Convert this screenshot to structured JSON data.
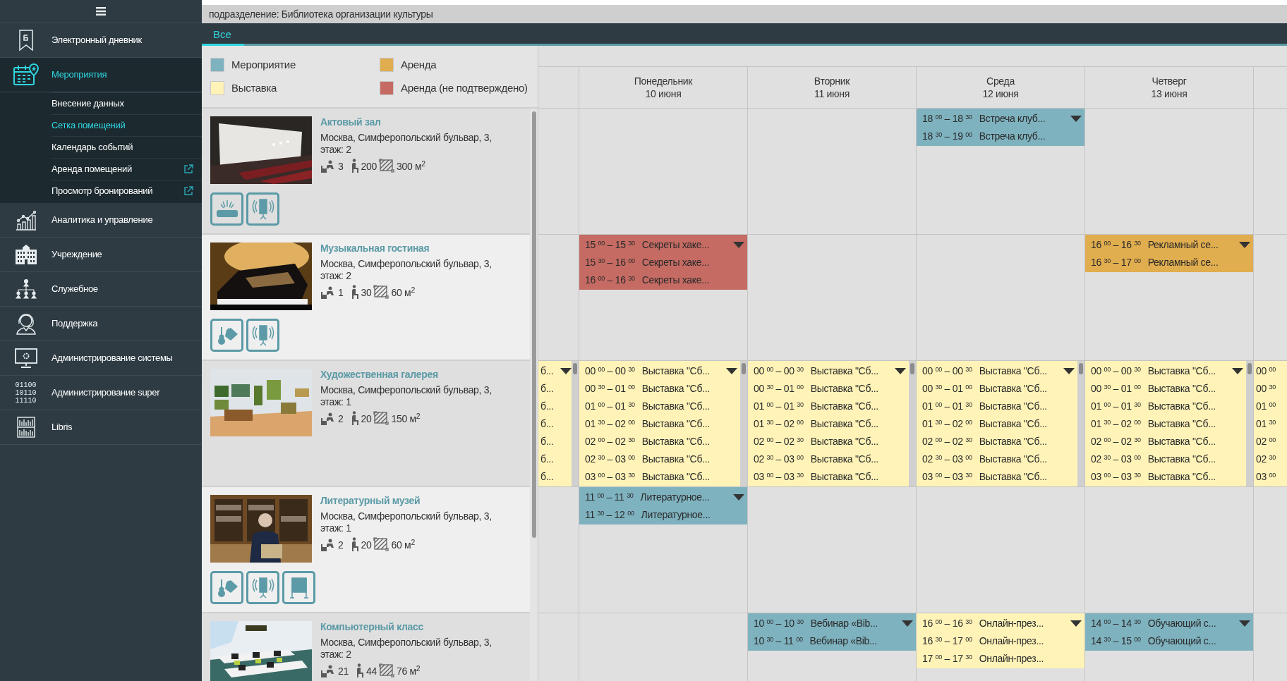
{
  "sidebar": {
    "items": [
      {
        "label": "Электронный дневник",
        "selected": false,
        "expanded": false
      },
      {
        "label": "Мероприятия",
        "selected": true,
        "expanded": true,
        "children": [
          {
            "label": "Внесение данных",
            "selected": false,
            "external": false
          },
          {
            "label": "Сетка помещений",
            "selected": true,
            "external": false
          },
          {
            "label": "Календарь событий",
            "selected": false,
            "external": false
          },
          {
            "label": "Аренда помещений",
            "selected": false,
            "external": true
          },
          {
            "label": "Просмотр бронирований",
            "selected": false,
            "external": true
          }
        ]
      },
      {
        "label": "Аналитика и управление",
        "selected": false,
        "expanded": false
      },
      {
        "label": "Учреждение",
        "selected": false,
        "expanded": false
      },
      {
        "label": "Служебное",
        "selected": false,
        "expanded": false
      },
      {
        "label": "Поддержка",
        "selected": false,
        "expanded": false
      },
      {
        "label": "Администрирование системы",
        "selected": false,
        "expanded": false
      },
      {
        "label": "Администрирование super",
        "selected": false,
        "expanded": false,
        "icon_text": [
          "01100",
          "10110",
          "11110"
        ]
      },
      {
        "label": "Libris",
        "selected": false,
        "expanded": false
      }
    ]
  },
  "header": {
    "subdivision": "подразделение: Библиотека организации культуры"
  },
  "tabs": [
    {
      "label": "Все",
      "selected": true
    }
  ],
  "legend": [
    {
      "label": "Мероприятие",
      "color": "#7fb2bf"
    },
    {
      "label": "Аренда",
      "color": "#e0ad4f"
    },
    {
      "label": "Выставка",
      "color": "#fff3b8"
    },
    {
      "label": "Аренда (не подтверждено)",
      "color": "#c56b63"
    }
  ],
  "rooms": [
    {
      "name": "Актовый зал",
      "address": "Москва, Симферопольский бульвар, 3,",
      "floor": "этаж: 2",
      "workplaces": "3",
      "seats": "200",
      "area": "300 м$^{2}$",
      "equipment": [
        {
          "kind": "projector"
        },
        {
          "kind": "speaker"
        }
      ]
    },
    {
      "name": "Музыкальная гостиная",
      "address": "Москва, Симферопольский бульвар, 3,",
      "floor": "этаж: 2",
      "workplaces": "1",
      "seats": "30",
      "area": "60 м$^{2}$",
      "equipment": [
        {
          "kind": "instruments"
        },
        {
          "kind": "speaker"
        }
      ]
    },
    {
      "name": "Художественная галерея",
      "address": "Москва, Симферопольский бульвар, 3,",
      "floor": "этаж: 1",
      "workplaces": "2",
      "seats": "20",
      "area": "150 м$^{2}$"
    },
    {
      "name": "Литературный музей",
      "address": "Москва, Симферопольский бульвар, 3,",
      "floor": "этаж: 1",
      "workplaces": "2",
      "seats": "20",
      "area": "60 м$^{2}$",
      "equipment": [
        {
          "kind": "instruments"
        },
        {
          "kind": "speaker"
        },
        {
          "kind": "flipchart"
        }
      ]
    },
    {
      "name": "Компьютерный класс",
      "address": "Москва, Симферопольский бульвар, 3,",
      "floor": "этаж: 2",
      "workplaces": "21",
      "seats": "44",
      "area": "76 м$^{2}$"
    }
  ],
  "calendar": {
    "days": [
      {
        "weekday": "Понедельник",
        "date": "10 июня"
      },
      {
        "weekday": "Вторник",
        "date": "11 июня"
      },
      {
        "weekday": "Среда",
        "date": "12 июня"
      },
      {
        "weekday": "Четверг",
        "date": "13 июня"
      }
    ],
    "rows": [
      {
        "cells": [
          {},
          {},
          {},
          {
            "color": "#7fb2bf",
            "dropdown": true,
            "scrollbar": false,
            "lines": [
              {
                "time": "18 $^{00}$ – 18 $^{30}$",
                "title": "Встреча клуб..."
              },
              {
                "time": "18 $^{30}$ – 19 $^{00}$",
                "title": "Встреча клуб..."
              }
            ]
          },
          {},
          {}
        ]
      },
      {
        "cells": [
          {},
          {
            "color": "#c56b63",
            "dropdown": true,
            "scrollbar": false,
            "lines": [
              {
                "time": "15 $^{00}$ – 15 $^{30}$",
                "title": "Секреты хаке..."
              },
              {
                "time": "15 $^{30}$ – 16 $^{00}$",
                "title": "Секреты хаке..."
              },
              {
                "time": "16 $^{00}$ – 16 $^{30}$",
                "title": "Секреты хаке..."
              }
            ]
          },
          {},
          {},
          {
            "color": "#e0ad4f",
            "dropdown": true,
            "scrollbar": false,
            "lines": [
              {
                "time": "16 $^{00}$ – 16 $^{30}$",
                "title": "Рекламный се..."
              },
              {
                "time": "16 $^{30}$ – 17 $^{00}$",
                "title": "Рекламный се..."
              }
            ]
          },
          {}
        ]
      },
      {
        "cells": [
          {
            "color": "#fff3b8",
            "dropdown": true,
            "scrollbar": true,
            "lines": [
              {
                "title": "б..."
              },
              {
                "title": "б..."
              },
              {
                "title": "б..."
              },
              {
                "title": "б..."
              },
              {
                "title": "б..."
              },
              {
                "title": "б..."
              },
              {
                "title": "б..."
              }
            ]
          },
          {
            "color": "#fff3b8",
            "dropdown": true,
            "scrollbar": true,
            "lines": [
              {
                "time": "00 $^{00}$ – 00 $^{30}$",
                "title": "Выставка \"Сб..."
              },
              {
                "time": "00 $^{30}$ – 01 $^{00}$",
                "title": "Выставка \"Сб..."
              },
              {
                "time": "01 $^{00}$ – 01 $^{30}$",
                "title": "Выставка \"Сб..."
              },
              {
                "time": "01 $^{30}$ – 02 $^{00}$",
                "title": "Выставка \"Сб..."
              },
              {
                "time": "02 $^{00}$ – 02 $^{30}$",
                "title": "Выставка \"Сб..."
              },
              {
                "time": "02 $^{30}$ – 03 $^{00}$",
                "title": "Выставка \"Сб..."
              },
              {
                "time": "03 $^{00}$ – 03 $^{30}$",
                "title": "Выставка \"Сб..."
              }
            ]
          },
          {
            "color": "#fff3b8",
            "dropdown": true,
            "scrollbar": true,
            "lines": [
              {
                "time": "00 $^{00}$ – 00 $^{30}$",
                "title": "Выставка \"Сб..."
              },
              {
                "time": "00 $^{30}$ – 01 $^{00}$",
                "title": "Выставка \"Сб..."
              },
              {
                "time": "01 $^{00}$ – 01 $^{30}$",
                "title": "Выставка \"Сб..."
              },
              {
                "time": "01 $^{30}$ – 02 $^{00}$",
                "title": "Выставка \"Сб..."
              },
              {
                "time": "02 $^{00}$ – 02 $^{30}$",
                "title": "Выставка \"Сб..."
              },
              {
                "time": "02 $^{30}$ – 03 $^{00}$",
                "title": "Выставка \"Сб..."
              },
              {
                "time": "03 $^{00}$ – 03 $^{30}$",
                "title": "Выставка \"Сб..."
              }
            ]
          },
          {
            "color": "#fff3b8",
            "dropdown": true,
            "scrollbar": true,
            "lines": [
              {
                "time": "00 $^{00}$ – 00 $^{30}$",
                "title": "Выставка \"Сб..."
              },
              {
                "time": "00 $^{30}$ – 01 $^{00}$",
                "title": "Выставка \"Сб..."
              },
              {
                "time": "01 $^{00}$ – 01 $^{30}$",
                "title": "Выставка \"Сб..."
              },
              {
                "time": "01 $^{30}$ – 02 $^{00}$",
                "title": "Выставка \"Сб..."
              },
              {
                "time": "02 $^{00}$ – 02 $^{30}$",
                "title": "Выставка \"Сб..."
              },
              {
                "time": "02 $^{30}$ – 03 $^{00}$",
                "title": "Выставка \"Сб..."
              },
              {
                "time": "03 $^{00}$ – 03 $^{30}$",
                "title": "Выставка \"Сб..."
              }
            ]
          },
          {
            "color": "#fff3b8",
            "dropdown": true,
            "scrollbar": true,
            "lines": [
              {
                "time": "00 $^{00}$ – 00 $^{30}$",
                "title": "Выставка \"Сб..."
              },
              {
                "time": "00 $^{30}$ – 01 $^{00}$",
                "title": "Выставка \"Сб..."
              },
              {
                "time": "01 $^{00}$ – 01 $^{30}$",
                "title": "Выставка \"Сб..."
              },
              {
                "time": "01 $^{30}$ – 02 $^{00}$",
                "title": "Выставка \"Сб..."
              },
              {
                "time": "02 $^{00}$ – 02 $^{30}$",
                "title": "Выставка \"Сб..."
              },
              {
                "time": "02 $^{30}$ – 03 $^{00}$",
                "title": "Выставка \"Сб..."
              },
              {
                "time": "03 $^{00}$ – 03 $^{30}$",
                "title": "Выставка \"Сб..."
              }
            ]
          },
          {
            "color": "#fff3b8",
            "dropdown": false,
            "scrollbar": false,
            "lines": [
              {
                "time": "00 $^{00}$"
              },
              {
                "time": "00 $^{30}$"
              },
              {
                "time": "01 $^{00}$"
              },
              {
                "time": "01 $^{30}$"
              },
              {
                "time": "02 $^{00}$"
              },
              {
                "time": "02 $^{30}$"
              },
              {
                "time": "03 $^{00}$"
              }
            ]
          }
        ]
      },
      {
        "cells": [
          {},
          {
            "color": "#7fb2bf",
            "dropdown": true,
            "scrollbar": false,
            "lines": [
              {
                "time": "11 $^{00}$ – 11 $^{30}$",
                "title": "Литературное..."
              },
              {
                "time": "11 $^{30}$ – 12 $^{00}$",
                "title": "Литературное..."
              }
            ]
          },
          {},
          {},
          {},
          {}
        ]
      },
      {
        "cells": [
          {},
          {},
          {
            "color": "#7fb2bf",
            "dropdown": true,
            "scrollbar": false,
            "lines": [
              {
                "time": "10 $^{00}$ – 10 $^{30}$",
                "title": "Вебинар «Bib..."
              },
              {
                "time": "10 $^{30}$ – 11 $^{00}$",
                "title": "Вебинар «Bib..."
              }
            ]
          },
          {
            "color": "#fff3b8",
            "dropdown": true,
            "scrollbar": false,
            "lines": [
              {
                "time": "16 $^{00}$ – 16 $^{30}$",
                "title": "Онлайн-през..."
              },
              {
                "time": "16 $^{30}$ – 17 $^{00}$",
                "title": "Онлайн-през..."
              },
              {
                "time": "17 $^{00}$ – 17 $^{30}$",
                "title": "Онлайн-през..."
              }
            ]
          },
          {
            "color": "#7fb2bf",
            "dropdown": true,
            "scrollbar": false,
            "lines": [
              {
                "time": "14 $^{00}$ – 14 $^{30}$",
                "title": "Обучающий с..."
              },
              {
                "time": "14 $^{30}$ – 15 $^{00}$",
                "title": "Обучающий с..."
              }
            ]
          },
          {}
        ]
      }
    ]
  }
}
